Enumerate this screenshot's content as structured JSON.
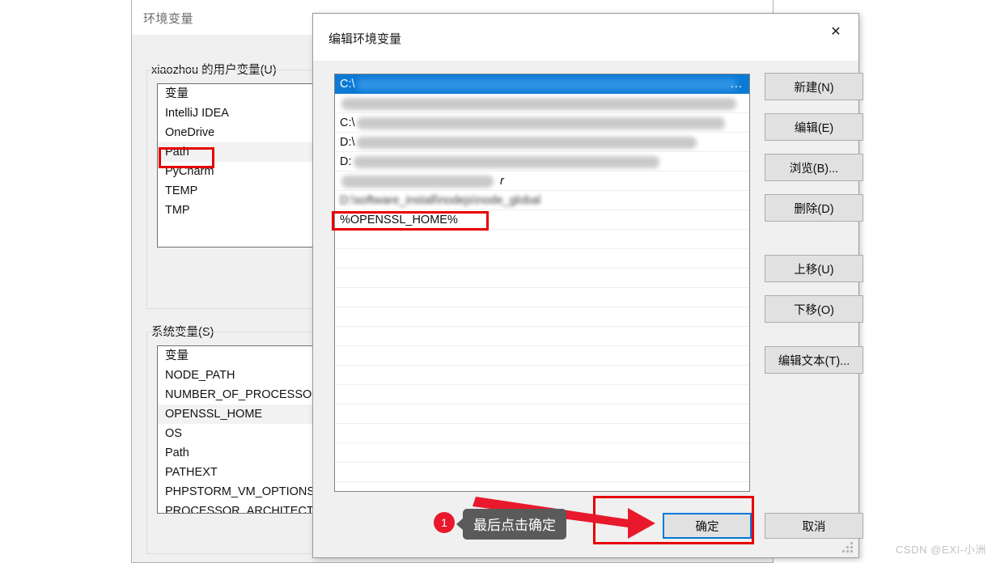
{
  "background_window": {
    "title": "环境变量",
    "close_icon": "close-icon",
    "user_vars": {
      "group_label": "xiaozhou 的用户变量(U)",
      "column_header": "变量",
      "rows": [
        "IntelliJ IDEA",
        "OneDrive",
        "Path",
        "PyCharm",
        "TEMP",
        "TMP"
      ],
      "selected_row": "Path"
    },
    "system_vars": {
      "group_label": "系统变量(S)",
      "column_header": "变量",
      "rows": [
        "NODE_PATH",
        "NUMBER_OF_PROCESSORS",
        "OPENSSL_HOME",
        "OS",
        "Path",
        "PATHEXT",
        "PHPSTORM_VM_OPTIONS",
        "PROCESSOR_ARCHITECTURE"
      ],
      "selected_row": "OPENSSL_HOME"
    }
  },
  "dialog": {
    "title": "编辑环境变量",
    "close_icon": "close-icon",
    "path_list": {
      "rows": [
        {
          "text": "C:\\",
          "selected": true,
          "redacted": true,
          "redacted_width": 470,
          "trailing": "..."
        },
        {
          "text": "",
          "selected": false,
          "redacted": true,
          "redacted_width": 480,
          "trailing": ""
        },
        {
          "text": "C:\\",
          "selected": false,
          "redacted": true,
          "redacted_width": 450,
          "trailing": ""
        },
        {
          "text": "D:\\",
          "selected": false,
          "redacted": true,
          "redacted_width": 420,
          "trailing": ""
        },
        {
          "text": "D:",
          "selected": false,
          "redacted": true,
          "redacted_width": 375,
          "trailing": ""
        },
        {
          "text": "",
          "selected": false,
          "redacted": true,
          "redacted_width": 185,
          "trailing": "r"
        },
        {
          "text": "D:\\software_install\\nodejs\\node_global",
          "selected": false,
          "redacted": false,
          "blurred": true,
          "trailing": ""
        },
        {
          "text": "%OPENSSL_HOME%",
          "selected": false,
          "redacted": false,
          "trailing": ""
        }
      ],
      "empty_rows": 13
    },
    "buttons": {
      "new": "新建(N)",
      "edit": "编辑(E)",
      "browse": "浏览(B)...",
      "delete": "删除(D)",
      "move_up": "上移(U)",
      "move_down": "下移(O)",
      "edit_text": "编辑文本(T)...",
      "ok": "确定",
      "cancel": "取消"
    }
  },
  "annotations": {
    "badge_number": "1",
    "tooltip_text": "最后点击确定",
    "highlight_color": "#e60000",
    "focus_color": "#0078d7"
  },
  "watermark": "CSDN @EXI-小洲"
}
